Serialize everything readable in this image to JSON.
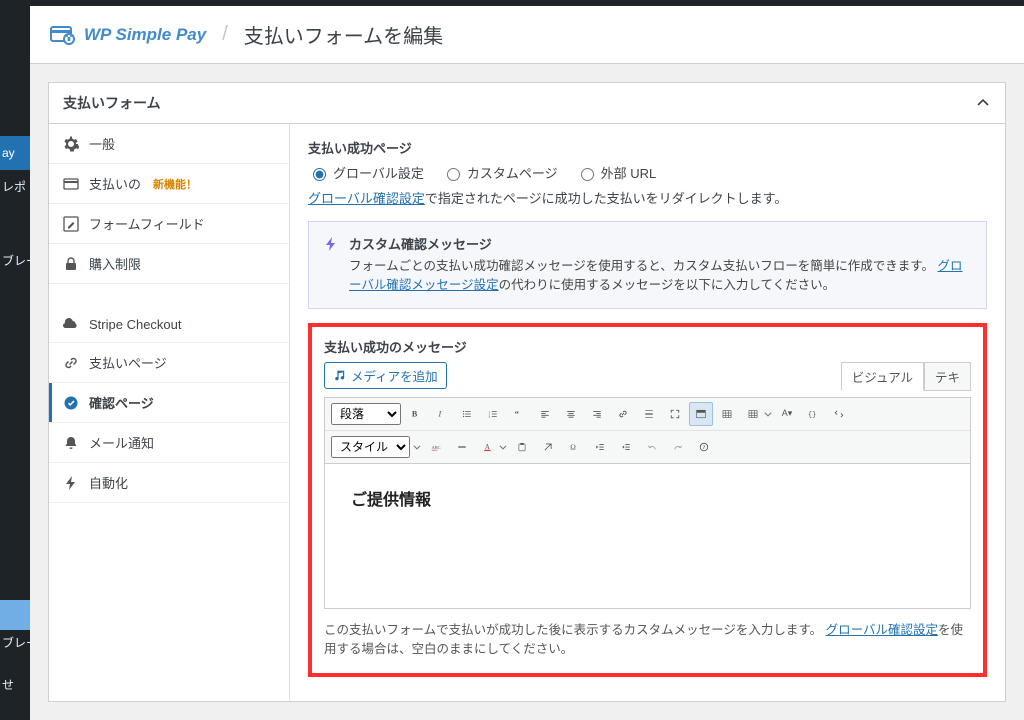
{
  "header": {
    "brand": "WP Simple Pay",
    "page_title": "支払いフォームを編集"
  },
  "panel": {
    "title": "支払いフォーム"
  },
  "wp_side_items": [
    "ay",
    "レポ",
    "",
    "ブレー",
    "",
    "ブレー",
    "",
    "せ"
  ],
  "nav": {
    "items": [
      {
        "icon": "gear",
        "label": "一般"
      },
      {
        "icon": "card",
        "label": "支払いの",
        "badge": "新機能！"
      },
      {
        "icon": "pencil-square",
        "label": "フォームフィールド"
      },
      {
        "icon": "lock",
        "label": "購入制限"
      },
      {
        "icon": "cloud",
        "label": "Stripe Checkout"
      },
      {
        "icon": "link",
        "label": "支払いページ"
      },
      {
        "icon": "check-circle",
        "label": "確認ページ"
      },
      {
        "icon": "bell",
        "label": "メール通知"
      },
      {
        "icon": "bolt",
        "label": "自動化"
      }
    ]
  },
  "success_page": {
    "label": "支払い成功ページ",
    "options": {
      "global": "グローバル設定",
      "custom": "カスタムページ",
      "external": "外部 URL"
    },
    "selected": "global",
    "desc_before": "",
    "desc_link": "グローバル確認設定",
    "desc_after": "で指定されたページに成功した支払いをリダイレクトします。"
  },
  "notice": {
    "title": "カスタム確認メッセージ",
    "text_before": "フォームごとの支払い成功確認メッセージを使用すると、カスタム支払いフローを簡単に作成できます。",
    "link": "グローバル確認メッセージ設定",
    "text_after": "の代わりに使用するメッセージを以下に入力してください。"
  },
  "editor": {
    "label": "支払い成功のメッセージ",
    "add_media": "メディアを追加",
    "tabs": {
      "visual": "ビジュアル",
      "text": "テキ"
    },
    "format_select": "段落",
    "style_select": "スタイル",
    "content": "ご提供情報",
    "help_before": "この支払いフォームで支払いが成功した後に表示するカスタムメッセージを入力します。",
    "help_link": "グローバル確認設定",
    "help_after": "を使用する場合は、空白のままにしてください。"
  }
}
